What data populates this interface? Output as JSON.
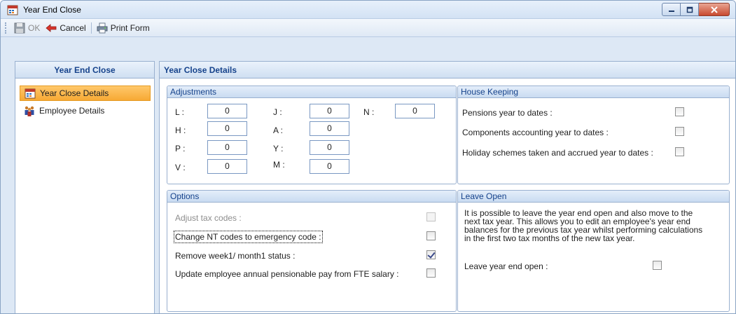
{
  "window": {
    "title": "Year End Close"
  },
  "toolbar": {
    "ok_label": "OK",
    "cancel_label": "Cancel",
    "print_label": "Print Form"
  },
  "nav": {
    "header": "Year End Close",
    "items": [
      {
        "label": "Year Close Details",
        "selected": true
      },
      {
        "label": "Employee Details",
        "selected": false
      }
    ]
  },
  "main": {
    "header": "Year Close Details",
    "adjustments": {
      "title": "Adjustments",
      "fields": [
        {
          "label": "L :",
          "value": "0"
        },
        {
          "label": "H :",
          "value": "0"
        },
        {
          "label": "P :",
          "value": "0"
        },
        {
          "label": "V :",
          "value": "0"
        },
        {
          "label": "J :",
          "value": "0"
        },
        {
          "label": "A :",
          "value": "0"
        },
        {
          "label": "Y :",
          "value": "0"
        },
        {
          "label": "M :",
          "value": "0"
        },
        {
          "label": "N :",
          "value": "0"
        }
      ]
    },
    "housekeeping": {
      "title": "House Keeping",
      "items": [
        {
          "label": "Pensions year to dates :",
          "checked": false
        },
        {
          "label": "Components accounting year to dates :",
          "checked": false
        },
        {
          "label": "Holiday schemes taken and accrued year to dates :",
          "checked": false
        }
      ]
    },
    "options": {
      "title": "Options",
      "items": [
        {
          "label": "Adjust tax codes :",
          "checked": false,
          "disabled": true
        },
        {
          "label": "Change NT codes to emergency code :",
          "checked": false,
          "disabled": false
        },
        {
          "label": "Remove week1/ month1 status :",
          "checked": true,
          "disabled": false
        },
        {
          "label": "Update employee annual pensionable pay from FTE salary :",
          "checked": false,
          "disabled": false
        }
      ]
    },
    "leave_open": {
      "title": "Leave Open",
      "description_lines": [
        "It is possible to leave the year end open and also move to the",
        "next tax year. This allows you to edit an employee's year end",
        "balances for the previous tax year whilst performing calculations",
        "in the first two tax months of the new tax year."
      ],
      "leave_open_label": "Leave year end open :",
      "leave_open_checked": false
    }
  }
}
